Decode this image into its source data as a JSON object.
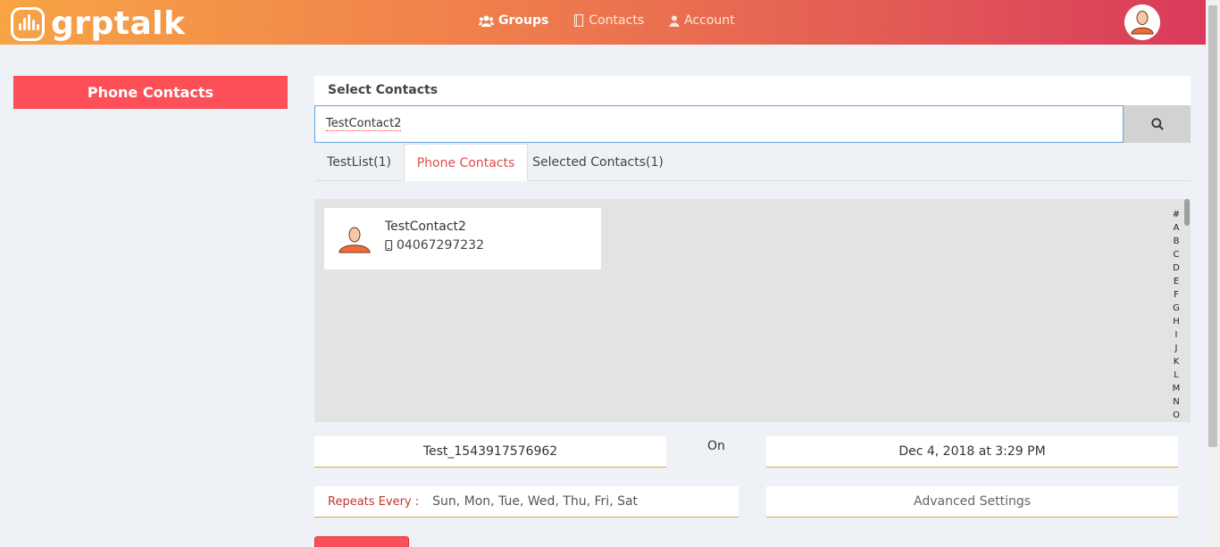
{
  "header": {
    "logo_text": "grptalk",
    "nav": [
      {
        "label": "Groups",
        "icon": "users-icon"
      },
      {
        "label": "Contacts",
        "icon": "contacts-book-icon"
      },
      {
        "label": "Account",
        "icon": "user-icon"
      }
    ]
  },
  "sidebar": {
    "active_button": "Phone Contacts"
  },
  "panel": {
    "title": "Select Contacts",
    "search": {
      "value": "TestContact2"
    },
    "tabs": [
      {
        "label": "TestList(1)"
      },
      {
        "label": "Phone Contacts"
      },
      {
        "label": "Selected Contacts(1)"
      }
    ],
    "active_tab": "Phone Contacts",
    "contacts": [
      {
        "name": "TestContact2",
        "phone": "04067297232"
      }
    ],
    "alphabet": [
      "#",
      "A",
      "B",
      "C",
      "D",
      "E",
      "F",
      "G",
      "H",
      "I",
      "J",
      "K",
      "L",
      "M",
      "N",
      "O"
    ]
  },
  "schedule": {
    "group_name": "Test_1543917576962",
    "on_label": "On",
    "datetime": "Dec 4, 2018 at 3:29 PM",
    "repeats_label": "Repeats Every :",
    "repeats_days": "Sun, Mon, Tue, Wed, Thu, Fri, Sat",
    "advanced_settings": "Advanced Settings"
  },
  "colors": {
    "accent": "#fd4f58",
    "tab_active_text": "#e24a4a",
    "field_underline": "#f0a040",
    "header_start": "#f7a445",
    "header_end": "#d93a5c"
  }
}
